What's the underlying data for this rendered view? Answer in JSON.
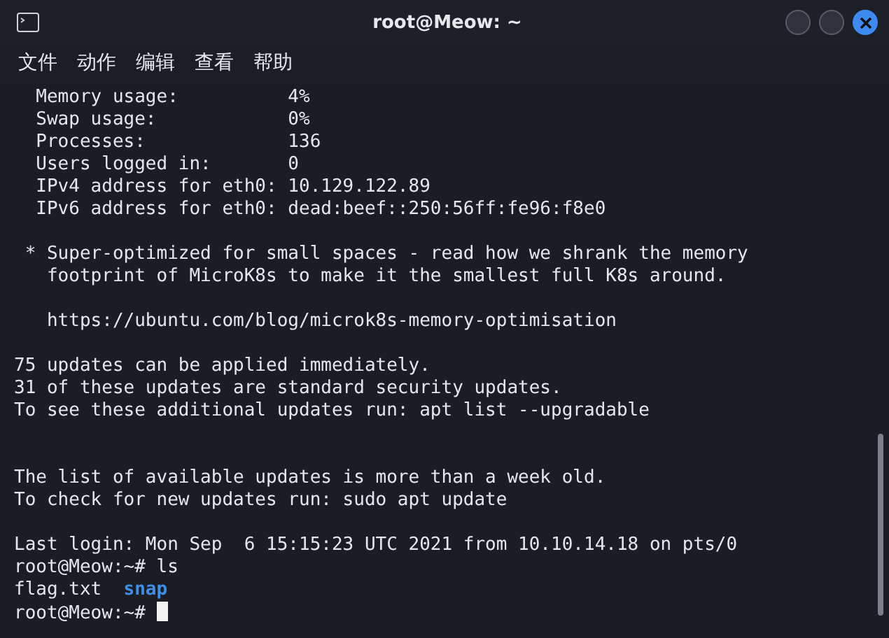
{
  "window": {
    "title": "root@Meow: ~"
  },
  "menu": [
    {
      "label": "文件"
    },
    {
      "label": "动作"
    },
    {
      "label": "编辑"
    },
    {
      "label": "查看"
    },
    {
      "label": "帮助"
    }
  ],
  "terminal": {
    "lines": [
      {
        "kind": "text",
        "text": "  Memory usage:          4%"
      },
      {
        "kind": "text",
        "text": "  Swap usage:            0%"
      },
      {
        "kind": "text",
        "text": "  Processes:             136"
      },
      {
        "kind": "text",
        "text": "  Users logged in:       0"
      },
      {
        "kind": "text",
        "text": "  IPv4 address for eth0: 10.129.122.89"
      },
      {
        "kind": "text",
        "text": "  IPv6 address for eth0: dead:beef::250:56ff:fe96:f8e0"
      },
      {
        "kind": "blank"
      },
      {
        "kind": "text",
        "text": " * Super-optimized for small spaces - read how we shrank the memory"
      },
      {
        "kind": "text",
        "text": "   footprint of MicroK8s to make it the smallest full K8s around."
      },
      {
        "kind": "blank"
      },
      {
        "kind": "text",
        "text": "   https://ubuntu.com/blog/microk8s-memory-optimisation"
      },
      {
        "kind": "blank"
      },
      {
        "kind": "text",
        "text": "75 updates can be applied immediately."
      },
      {
        "kind": "text",
        "text": "31 of these updates are standard security updates."
      },
      {
        "kind": "text",
        "text": "To see these additional updates run: apt list --upgradable"
      },
      {
        "kind": "blank"
      },
      {
        "kind": "blank"
      },
      {
        "kind": "text",
        "text": "The list of available updates is more than a week old."
      },
      {
        "kind": "text",
        "text": "To check for new updates run: sudo apt update"
      },
      {
        "kind": "blank"
      },
      {
        "kind": "text",
        "text": "Last login: Mon Sep  6 15:15:23 UTC 2021 from 10.10.14.18 on pts/0"
      },
      {
        "kind": "prompt",
        "prompt": "root@Meow:~#",
        "command": "ls"
      },
      {
        "kind": "listing",
        "entries": [
          {
            "name": "flag.txt",
            "kind": "file"
          },
          {
            "name": "snap",
            "kind": "directory"
          }
        ]
      },
      {
        "kind": "prompt",
        "prompt": "root@Meow:~#",
        "cursor": true
      }
    ]
  }
}
